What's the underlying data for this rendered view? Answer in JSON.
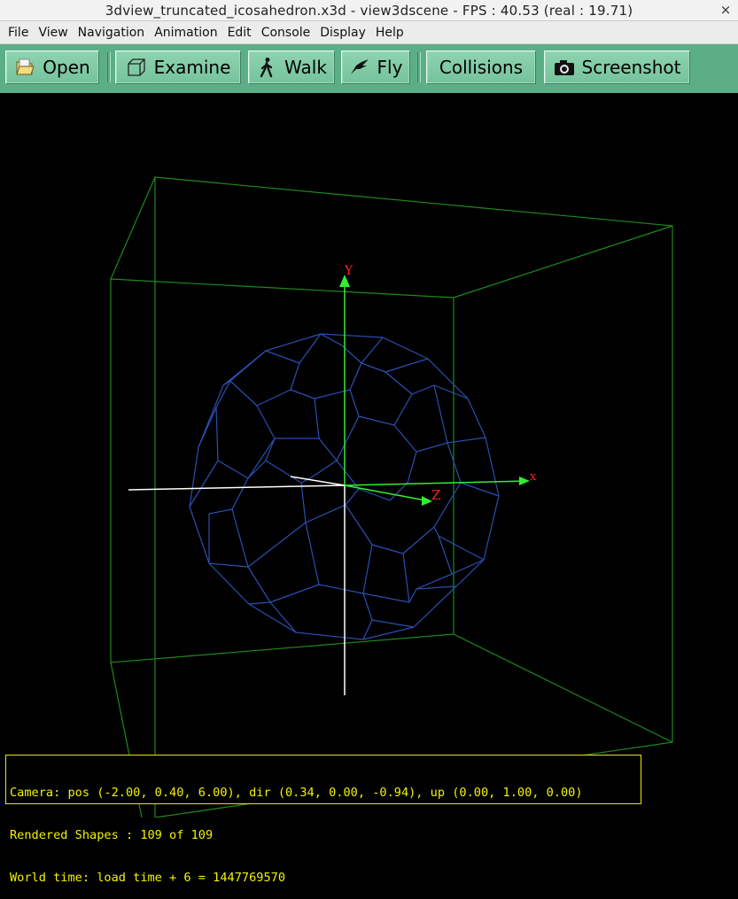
{
  "window": {
    "title": "3dview_truncated_icosahedron.x3d - view3dscene - FPS : 40.53 (real : 19.71)",
    "close_glyph": "×"
  },
  "menu": [
    "File",
    "View",
    "Navigation",
    "Animation",
    "Edit",
    "Console",
    "Display",
    "Help"
  ],
  "toolbar": {
    "open": "Open",
    "examine": "Examine",
    "walk": "Walk",
    "fly": "Fly",
    "collisions": "Collisions",
    "screenshot": "Screenshot"
  },
  "axes": {
    "x": "x",
    "y": "Y",
    "z": "Z"
  },
  "status": {
    "camera": "Camera: pos (-2.00, 0.40, 6.00), dir (0.34, 0.00, -0.94), up (0.00, 1.00, 0.00)",
    "shapes": "Rendered Shapes : 109 of 109",
    "time": "World time: load time + 6 = 1447769570"
  },
  "colors": {
    "background": "#000000",
    "bounding_box": "#1e8a1e",
    "mesh": "#2a4fb0",
    "axis_label": "#ff2020",
    "status_text": "#f2f200",
    "toolbar": "#5cae86"
  }
}
